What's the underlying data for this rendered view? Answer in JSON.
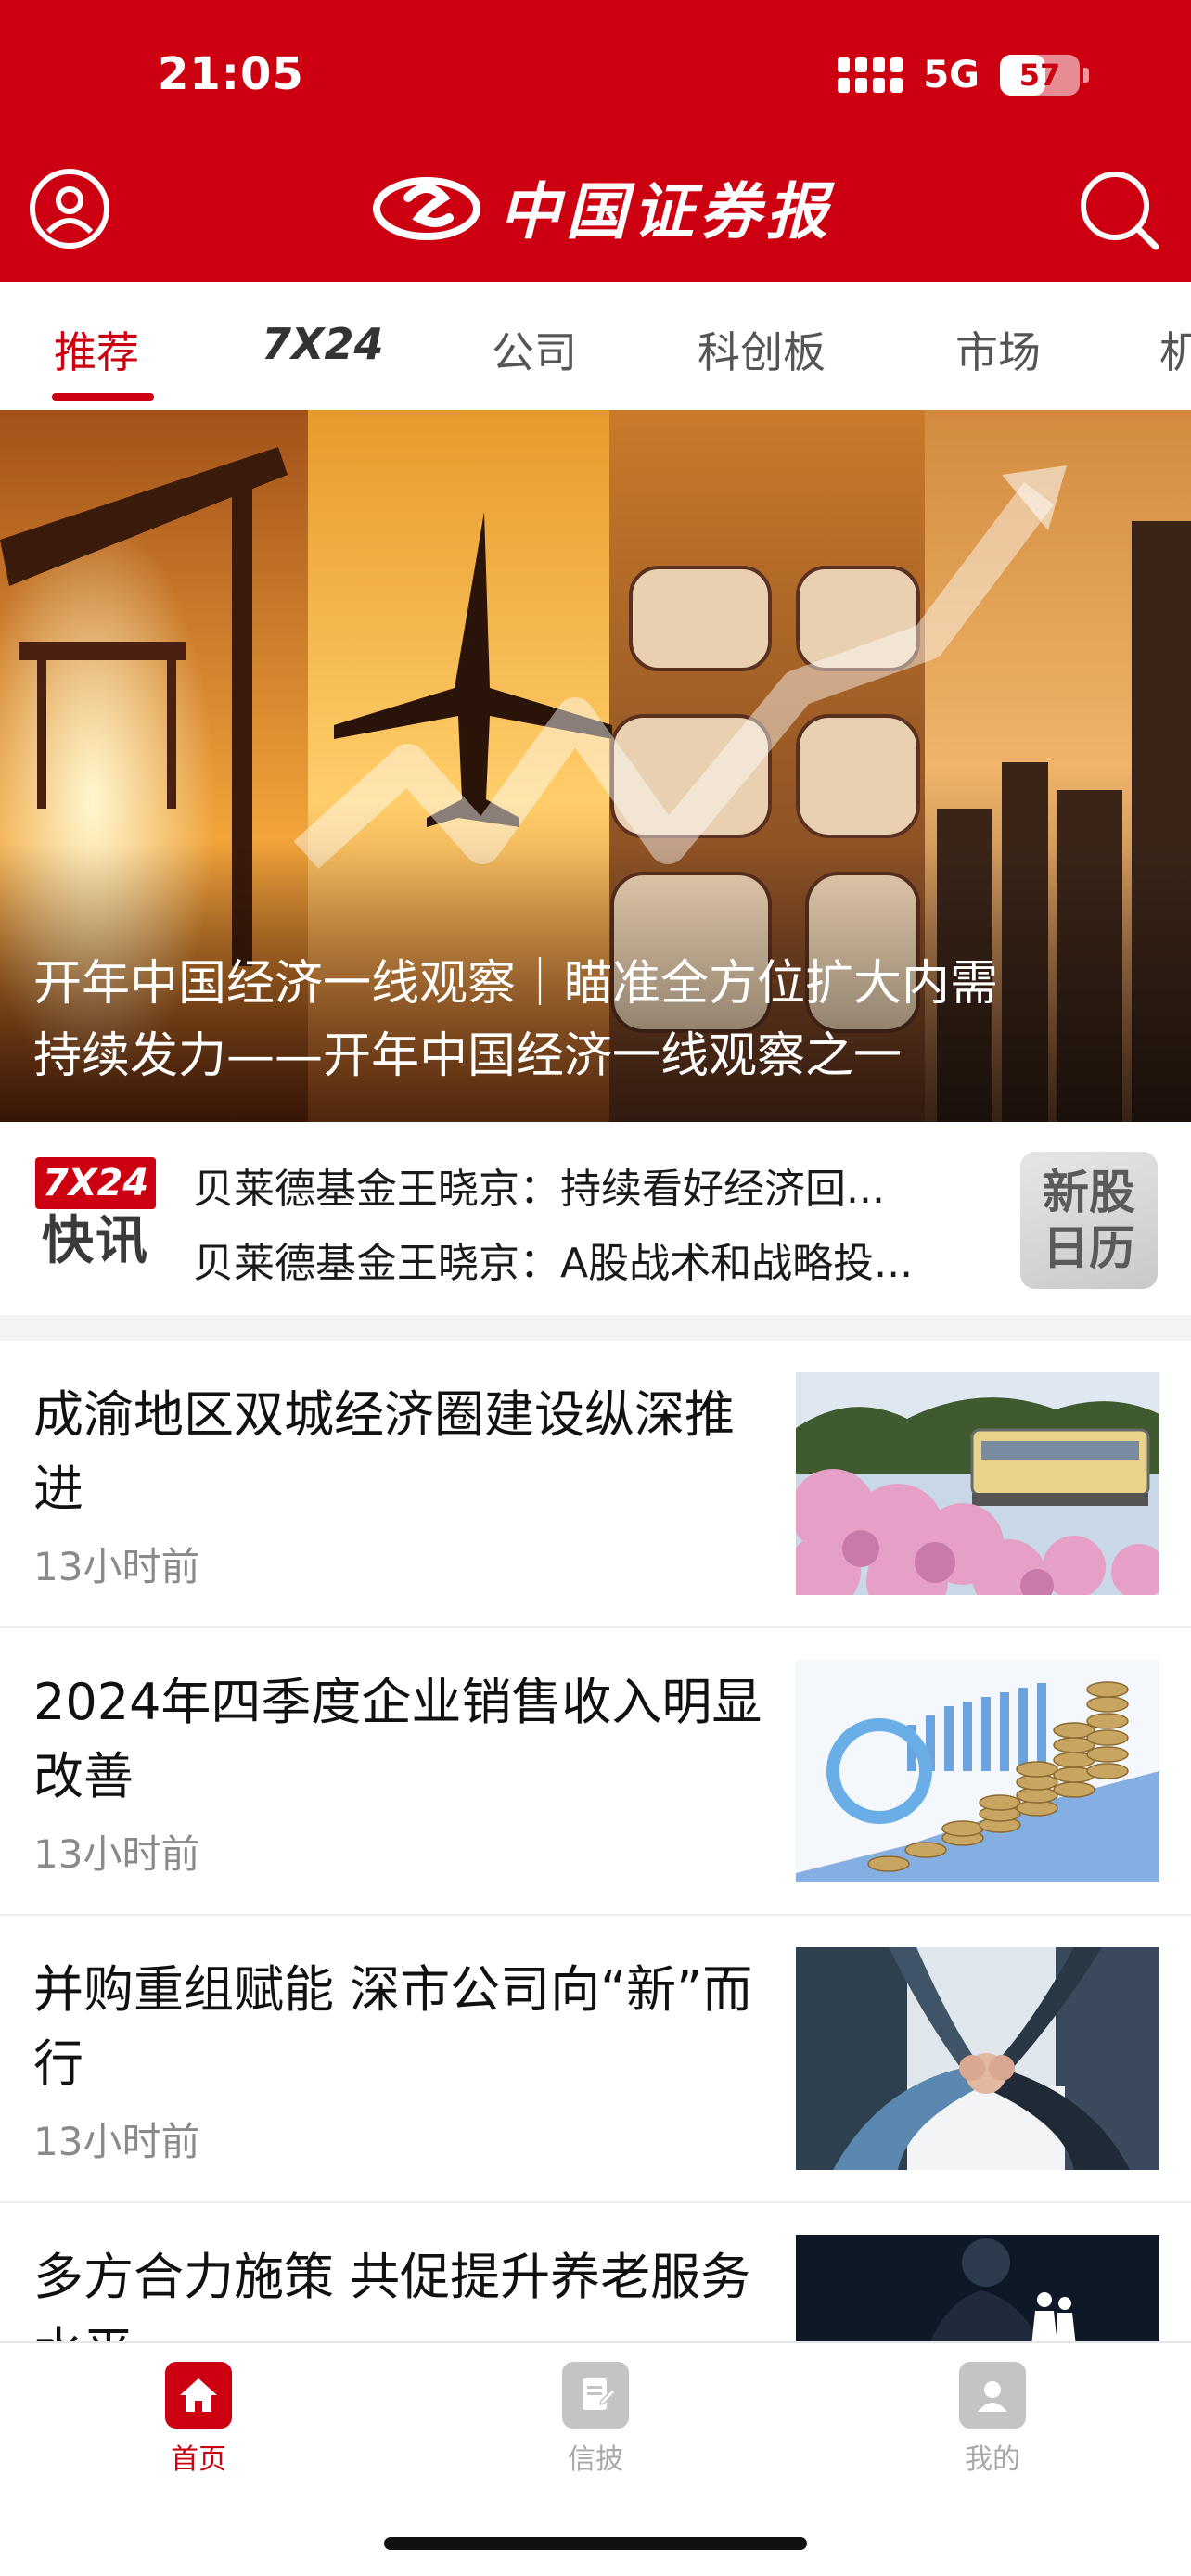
{
  "status_bar": {
    "time": "21:05",
    "network": "5G",
    "battery": "57",
    "battery_level": 0.57
  },
  "header": {
    "logo_text": "中国证券报",
    "user_icon": "user-icon",
    "search_icon": "search-icon"
  },
  "tabs": [
    {
      "label": "推荐",
      "active": true
    },
    {
      "label": "7X24",
      "active": false
    },
    {
      "label": "公司",
      "active": false
    },
    {
      "label": "科创板",
      "active": false
    },
    {
      "label": "市场",
      "active": false
    },
    {
      "label": "机",
      "active": false
    }
  ],
  "hero": {
    "title_line1": "开年中国经济一线观察｜瞄准全方位扩大内需",
    "title_line2": "持续发力——开年中国经济一线观察之一"
  },
  "flash": {
    "badge_top": "7X24",
    "badge_bottom": "快讯",
    "items": [
      "贝莱德基金王晓京：持续看好经济回...",
      "贝莱德基金王晓京：A股战术和战略投..."
    ],
    "ipo_line1": "新股",
    "ipo_line2": "日历"
  },
  "articles": [
    {
      "title": "成渝地区双城经济圈建设纵深推进",
      "time": "13小时前",
      "image": "cherry-blossom-train"
    },
    {
      "title": "2024年四季度企业销售收入明显改善",
      "time": "13小时前",
      "image": "coins-chart"
    },
    {
      "title": "并购重组赋能 深市公司向“新”而行",
      "time": "13小时前",
      "image": "hands-together"
    },
    {
      "title": "多方合力施策 共促提升养老服务水平",
      "time": "",
      "image": "elderly-couple"
    }
  ],
  "bottom_nav": [
    {
      "label": "首页",
      "icon": "home-icon",
      "active": true
    },
    {
      "label": "信披",
      "icon": "disclosure-icon",
      "active": false
    },
    {
      "label": "我的",
      "icon": "profile-icon",
      "active": false
    }
  ],
  "colors": {
    "brand_red": "#cc0011",
    "muted_gray": "#8a8a8a"
  }
}
